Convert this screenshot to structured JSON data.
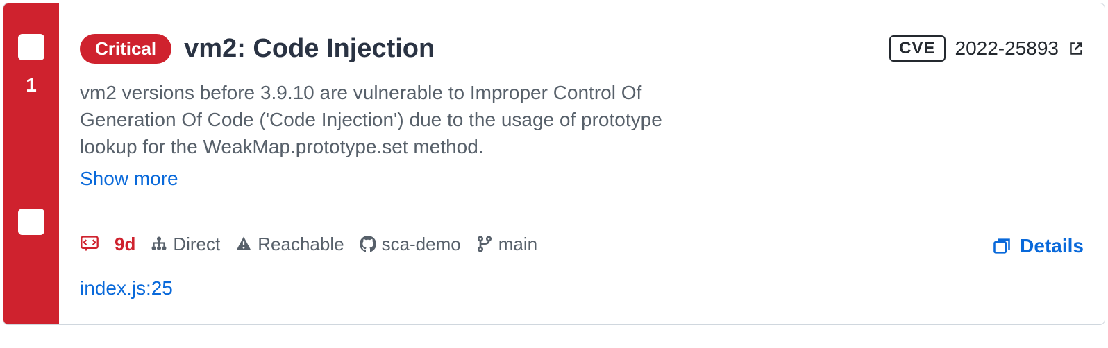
{
  "count": "1",
  "severity": "Critical",
  "title": "vm2: Code Injection",
  "cve": {
    "label": "CVE",
    "number": "2022-25893"
  },
  "description": "vm2 versions before 3.9.10 are vulnerable to Improper Control Of Generation Of Code ('Code Injection') due to the usage of prototype lookup for the WeakMap.prototype.set method.",
  "show_more": "Show more",
  "meta": {
    "age": "9d",
    "dependency": "Direct",
    "reachable": "Reachable",
    "repo": "sca-demo",
    "branch": "main"
  },
  "details_label": "Details",
  "file_location": "index.js:25"
}
